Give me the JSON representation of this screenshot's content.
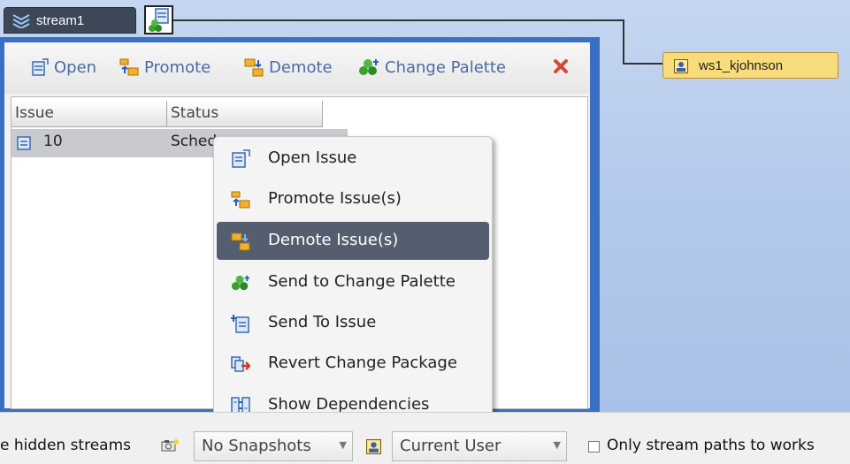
{
  "stream": {
    "name": "stream1"
  },
  "workspace": {
    "name": "ws1_kjohnson"
  },
  "toolbar": {
    "open_label": "Open",
    "promote_label": "Promote",
    "demote_label": "Demote",
    "change_palette_label": "Change Palette"
  },
  "grid": {
    "columns": [
      "Issue",
      "Status"
    ],
    "rows": [
      {
        "issue": "10",
        "status": "Sched"
      }
    ]
  },
  "context_menu": {
    "items": [
      {
        "label": "Open Issue",
        "icon": "open-issue-icon"
      },
      {
        "label": "Promote Issue(s)",
        "icon": "promote-icon"
      },
      {
        "label": "Demote Issue(s)",
        "icon": "demote-icon",
        "selected": true
      },
      {
        "label": "Send to Change Palette",
        "icon": "change-palette-icon"
      },
      {
        "label": "Send To Issue",
        "icon": "send-to-issue-icon"
      },
      {
        "label": "Revert Change Package",
        "icon": "revert-icon"
      },
      {
        "label": "Show Dependencies",
        "icon": "dependencies-icon"
      }
    ]
  },
  "bottom_bar": {
    "hidden_streams_text": "e hidden streams",
    "snapshots_value": "No Snapshots",
    "user_value": "Current User",
    "only_paths_label": "Only stream paths to works"
  },
  "colors": {
    "panel_border": "#3a70c4",
    "menu_selected": "#555e6e",
    "workspace_fill": "#f8db7b"
  }
}
